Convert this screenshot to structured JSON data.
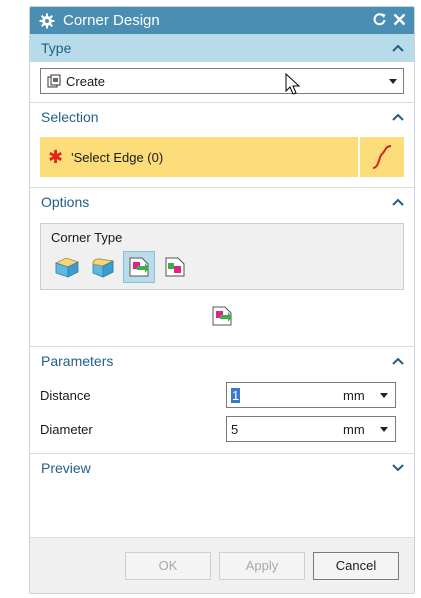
{
  "window": {
    "title": "Corner Design",
    "reset_icon": "reset-icon",
    "close_icon": "close-icon"
  },
  "type_section": {
    "header": "Type",
    "selected": "Create",
    "selected_icon": "create-icon"
  },
  "selection_section": {
    "header": "Selection",
    "prompt": "'Select Edge (0)",
    "required_marker": "✱"
  },
  "options_section": {
    "header": "Options",
    "corner_type_label": "Corner Type",
    "corner_types": [
      "corner-type-1-icon",
      "corner-type-2-icon",
      "corner-type-3-icon",
      "corner-type-4-icon"
    ],
    "selected_index": 2,
    "preview_icon": "corner-type-preview-icon"
  },
  "parameters_section": {
    "header": "Parameters",
    "rows": [
      {
        "label": "Distance",
        "value": "1",
        "unit": "mm"
      },
      {
        "label": "Diameter",
        "value": "5",
        "unit": "mm"
      }
    ]
  },
  "preview_section": {
    "header": "Preview"
  },
  "buttons": {
    "ok": "OK",
    "apply": "Apply",
    "cancel": "Cancel"
  },
  "colors": {
    "titlebar": "#4a8fb3",
    "active_header": "#b7dbe8",
    "selection_highlight": "#fddc7a",
    "section_text": "#1f5f8a",
    "required_star": "#e2231a"
  }
}
